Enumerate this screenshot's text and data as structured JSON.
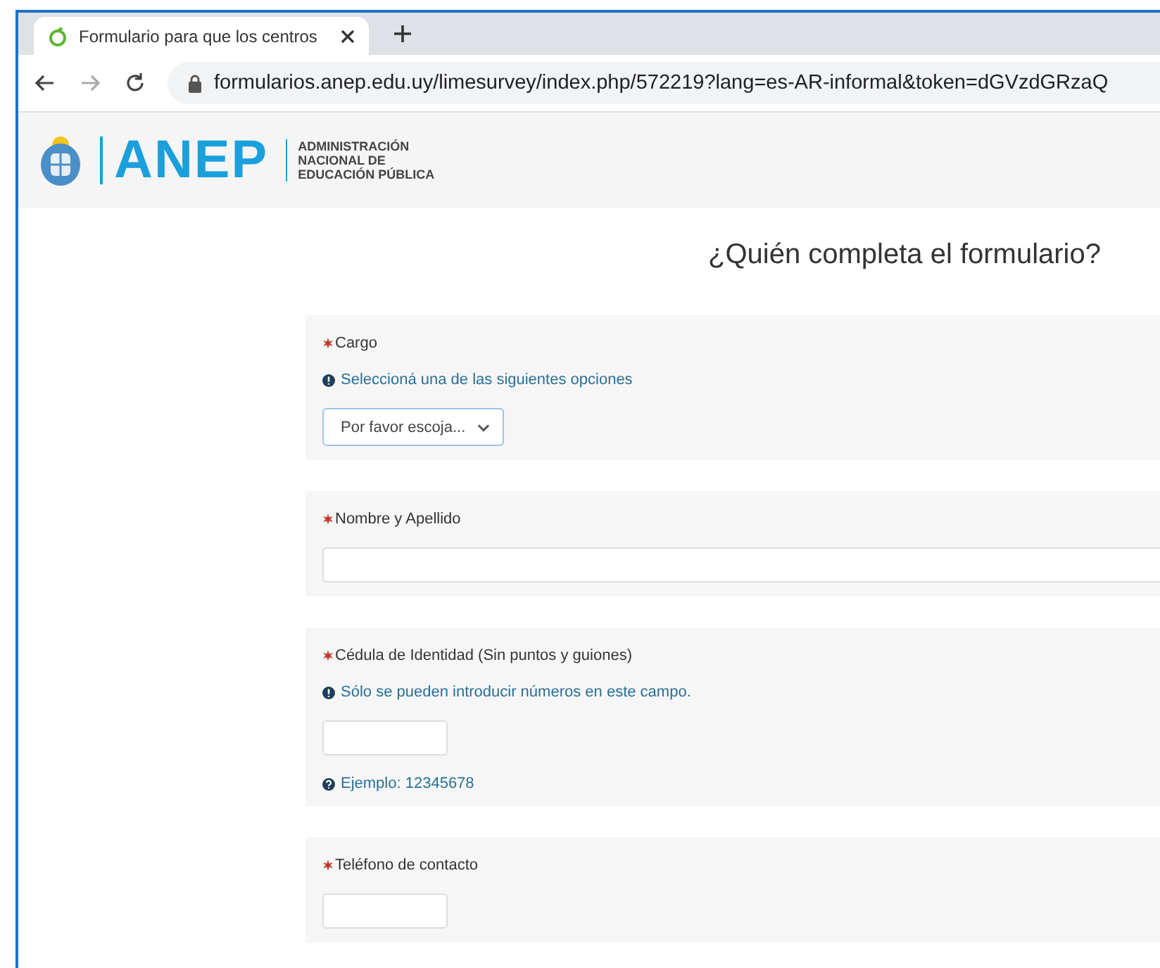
{
  "browser": {
    "tab": {
      "title": "Formulario para que los centros",
      "selected": true
    },
    "url": "formularios.anep.edu.uy/limesurvey/index.php/572219?lang=es-AR-informal&token=dGVzdGRzaQ"
  },
  "header": {
    "brand": "ANEP",
    "subtitle": [
      "ADMINISTRACIÓN",
      "NACIONAL DE",
      "EDUCACIÓN PÚBLICA"
    ]
  },
  "page_title": "¿Quién completa el formulario?",
  "questions": [
    {
      "kind": "select",
      "label": "Cargo",
      "required": true,
      "hint": "Seleccioná una de las siguientes opciones",
      "value": "Por favor escoja..."
    },
    {
      "kind": "wide",
      "label": "Nombre y Apellido",
      "required": true
    },
    {
      "kind": "short",
      "label": "Cédula de Identidad (Sin puntos y guiones)",
      "required": true,
      "hint": "Sólo se pueden introducir números en este campo.",
      "example": "Ejemplo: 12345678"
    },
    {
      "kind": "short",
      "label": "Teléfono de contacto",
      "required": true
    }
  ]
}
